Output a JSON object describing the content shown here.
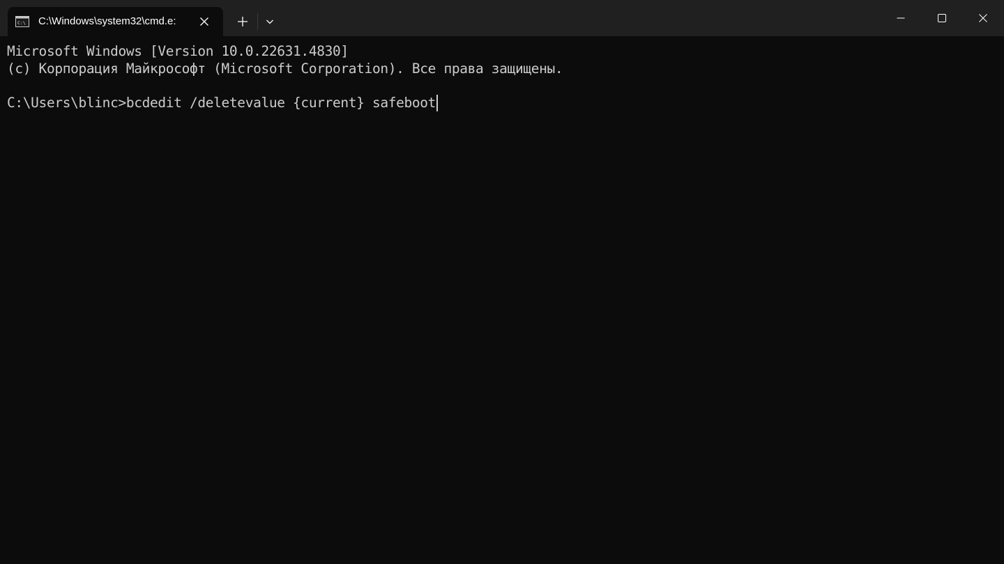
{
  "window": {
    "tab_title": "C:\\Windows\\system32\\cmd.e:",
    "controls": {
      "minimize": "minimize-icon",
      "maximize": "maximize-icon",
      "close": "close-icon"
    }
  },
  "terminal": {
    "lines": [
      "Microsoft Windows [Version 10.0.22631.4830]",
      "(c) Корпорация Майкрософт (Microsoft Corporation). Все права защищены.",
      "",
      "C:\\Users\\blinc>bcdedit /deletevalue {current} safeboot"
    ]
  },
  "colors": {
    "titlebar": "#202020",
    "background": "#0c0c0c",
    "text": "#cccccc"
  }
}
